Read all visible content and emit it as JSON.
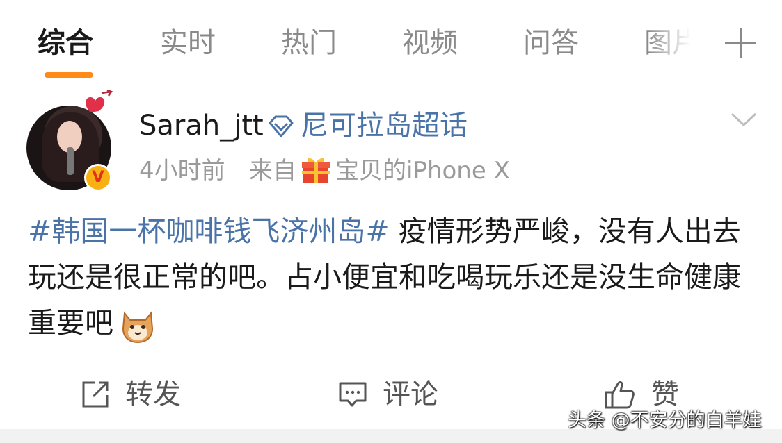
{
  "tabs": [
    {
      "label": "综合",
      "active": true
    },
    {
      "label": "实时",
      "active": false
    },
    {
      "label": "热门",
      "active": false
    },
    {
      "label": "视频",
      "active": false
    },
    {
      "label": "问答",
      "active": false
    },
    {
      "label": "图片",
      "active": false
    }
  ],
  "tab_add_icon": "plus-icon",
  "colors": {
    "accent": "#ff8a1a",
    "link": "#4a74a8",
    "verified_badge": "#f9b012"
  },
  "post": {
    "username": "Sarah_jtt",
    "super_topic_icon": "diamond-icon",
    "super_topic": "尼可拉岛超话",
    "time": "4小时前",
    "source_prefix": "来自",
    "source_icon": "gift-icon",
    "source_device": "宝贝的iPhone X",
    "verified_badge": "V",
    "hashtag": "#韩国一杯咖啡钱飞济州岛#",
    "text": " 疫情形势严峻，没有人出去玩还是很正常的吧。占小便宜和吃喝玩乐还是没生命健康重要吧",
    "emoji": "cat-emoji"
  },
  "actions": {
    "forward": "转发",
    "comment": "评论",
    "like": "赞"
  },
  "watermark": "头条 @不安分的白羊娃"
}
